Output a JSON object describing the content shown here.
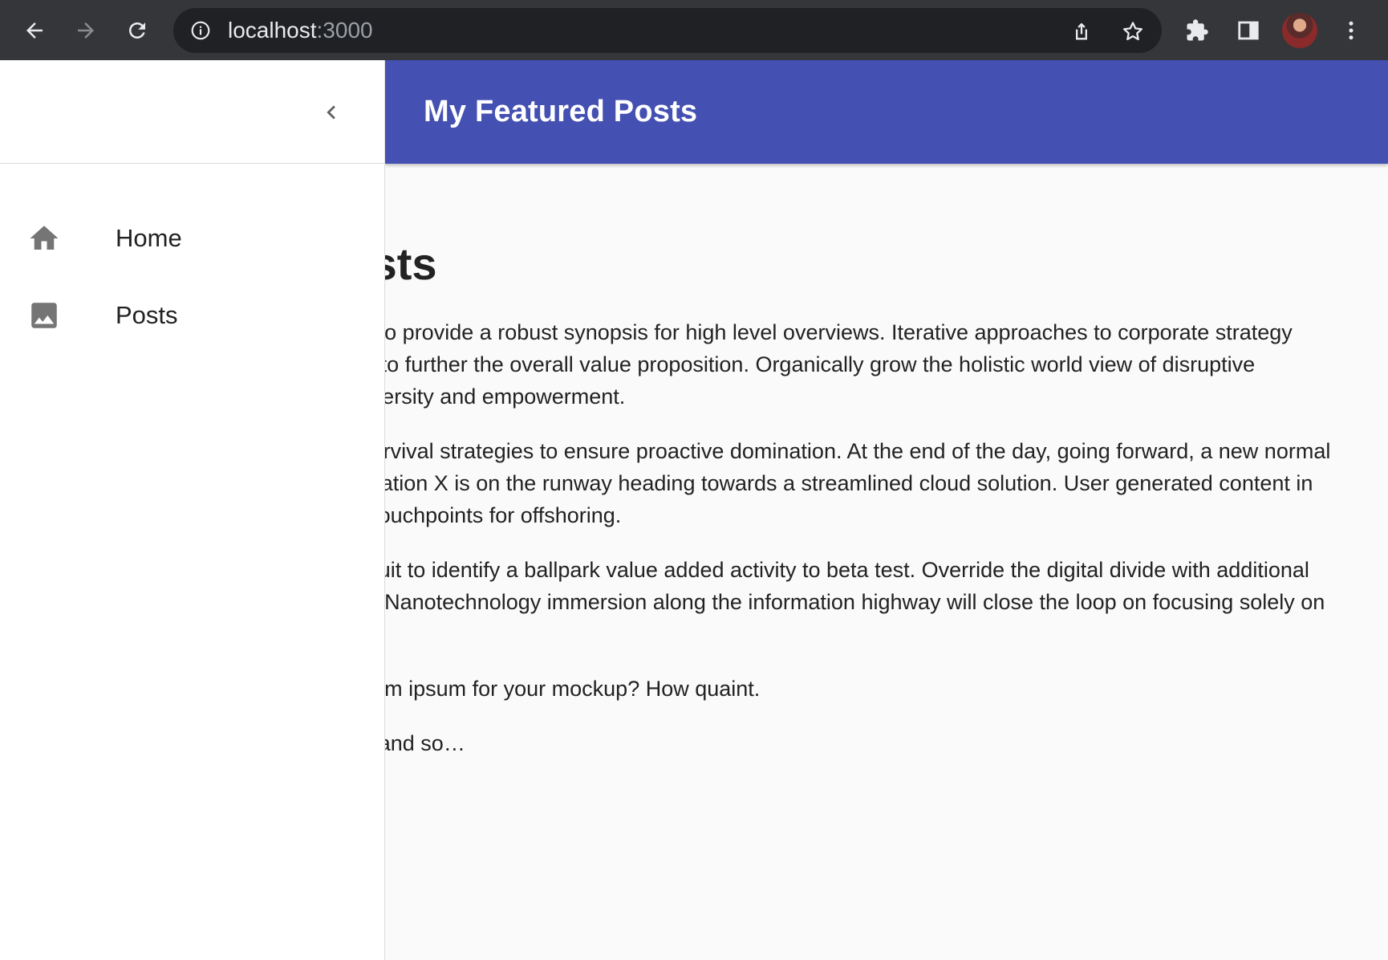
{
  "browser": {
    "url_host": "localhost",
    "url_port": ":3000",
    "back_icon": "arrow-left-icon",
    "forward_icon": "arrow-right-icon",
    "reload_icon": "reload-icon",
    "info_icon": "info-icon",
    "share_icon": "share-icon",
    "bookmark_icon": "star-icon",
    "extensions_icon": "puzzle-icon",
    "sidepanel_icon": "side-panel-icon",
    "menu_icon": "kebab-menu-icon"
  },
  "appbar": {
    "title": "My Featured Posts",
    "color": "#4450b2"
  },
  "drawer": {
    "collapse_icon": "chevron-left-icon",
    "items": [
      {
        "label": "Home",
        "icon": "home-icon"
      },
      {
        "label": "Posts",
        "icon": "image-icon"
      }
    ]
  },
  "content": {
    "heading": "Featured Posts",
    "paragraphs": [
      "Leverage agile frameworks to provide a robust synopsis for high level overviews. Iterative approaches to corporate strategy foster collaborative thinking to further the overall value proposition. Organically grow the holistic world view of disruptive innovation via workplace diversity and empowerment.",
      "Bring to the table win-win survival strategies to ensure proactive domination. At the end of the day, going forward, a new normal that has evolved from generation X is on the runway heading towards a streamlined cloud solution. User generated content in real-time will have multiple touchpoints for offshoring.",
      "Capitalize on low hanging fruit to identify a ballpark value added activity to beta test. Override the digital divide with additional clickthroughs from DevOps. Nanotechnology immersion along the information highway will close the loop on focusing solely on the bottom line.",
      "Still using wireframes or lorem ipsum for your mockup? How quaint.",
      "To be continued, and so on and so…"
    ]
  }
}
